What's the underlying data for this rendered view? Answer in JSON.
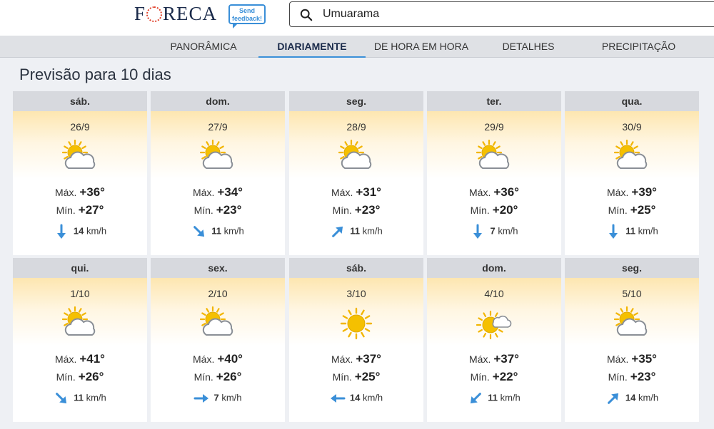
{
  "header": {
    "logo_left": "F",
    "logo_right": "RECA",
    "feedback_line1": "Send",
    "feedback_line2": "feedback!",
    "search_value": "Umuarama"
  },
  "nav": {
    "tabs": [
      "PANORÂMICA",
      "DIARIAMENTE",
      "DE HORA EM HORA",
      "DETALHES",
      "PRECIPITAÇÃO"
    ],
    "active": "DIARIAMENTE"
  },
  "page_title": "Previsão para 10 dias",
  "labels": {
    "max": "Máx.",
    "min": "Mín.",
    "unit": "km/h"
  },
  "colors": {
    "accent": "#3a8fd8",
    "sun": "#f2b500",
    "wind_arrow": "#3a8fd8",
    "day_bar": "#d7d9de"
  },
  "days": [
    {
      "day": "sáb.",
      "date": "26/9",
      "icon": "partly-cloudy-icon",
      "max": "+36°",
      "min": "+27°",
      "wind": "14",
      "wind_dir": "south"
    },
    {
      "day": "dom.",
      "date": "27/9",
      "icon": "partly-cloudy-icon",
      "max": "+34°",
      "min": "+23°",
      "wind": "11",
      "wind_dir": "south-east"
    },
    {
      "day": "seg.",
      "date": "28/9",
      "icon": "partly-cloudy-icon",
      "max": "+31°",
      "min": "+23°",
      "wind": "11",
      "wind_dir": "north-east"
    },
    {
      "day": "ter.",
      "date": "29/9",
      "icon": "partly-cloudy-icon",
      "max": "+36°",
      "min": "+20°",
      "wind": "7",
      "wind_dir": "south"
    },
    {
      "day": "qua.",
      "date": "30/9",
      "icon": "partly-cloudy-icon",
      "max": "+39°",
      "min": "+25°",
      "wind": "11",
      "wind_dir": "south"
    },
    {
      "day": "qui.",
      "date": "1/10",
      "icon": "partly-cloudy-icon",
      "max": "+41°",
      "min": "+26°",
      "wind": "11",
      "wind_dir": "south-east"
    },
    {
      "day": "sex.",
      "date": "2/10",
      "icon": "partly-cloudy-icon",
      "max": "+40°",
      "min": "+26°",
      "wind": "7",
      "wind_dir": "east"
    },
    {
      "day": "sáb.",
      "date": "3/10",
      "icon": "sunny-icon",
      "max": "+37°",
      "min": "+25°",
      "wind": "14",
      "wind_dir": "west"
    },
    {
      "day": "dom.",
      "date": "4/10",
      "icon": "mostly-sunny-icon",
      "max": "+37°",
      "min": "+22°",
      "wind": "11",
      "wind_dir": "south-west"
    },
    {
      "day": "seg.",
      "date": "5/10",
      "icon": "partly-cloudy-icon",
      "max": "+35°",
      "min": "+23°",
      "wind": "14",
      "wind_dir": "north-east"
    }
  ]
}
